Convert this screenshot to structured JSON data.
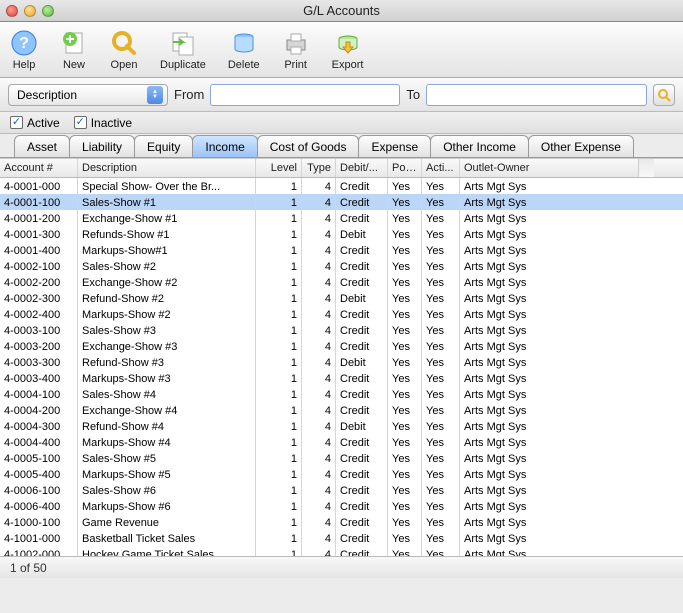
{
  "window": {
    "title": "G/L Accounts"
  },
  "toolbar": {
    "help": "Help",
    "new": "New",
    "open": "Open",
    "duplicate": "Duplicate",
    "delete": "Delete",
    "print": "Print",
    "export": "Export"
  },
  "search": {
    "field": "Description",
    "from_label": "From",
    "to_label": "To",
    "from_value": "",
    "to_value": ""
  },
  "filters": {
    "active_label": "Active",
    "inactive_label": "Inactive"
  },
  "tabs": [
    "Asset",
    "Liability",
    "Equity",
    "Income",
    "Cost of Goods",
    "Expense",
    "Other Income",
    "Other Expense"
  ],
  "active_tab": 3,
  "columns": {
    "acct": "Account #",
    "desc": "Description",
    "level": "Level",
    "type": "Type",
    "dc": "Debit/...",
    "posted": "Pos...",
    "active": "Acti...",
    "owner": "Outlet-Owner"
  },
  "rows": [
    {
      "acct": "4-0001-000",
      "desc": "Special Show- Over the Br...",
      "level": "1",
      "type": "4",
      "dc": "Credit",
      "posted": "Yes",
      "active": "Yes",
      "owner": "Arts Mgt Sys"
    },
    {
      "acct": "4-0001-100",
      "desc": "Sales-Show #1",
      "level": "1",
      "type": "4",
      "dc": "Credit",
      "posted": "Yes",
      "active": "Yes",
      "owner": "Arts Mgt Sys",
      "selected": true
    },
    {
      "acct": "4-0001-200",
      "desc": "Exchange-Show #1",
      "level": "1",
      "type": "4",
      "dc": "Credit",
      "posted": "Yes",
      "active": "Yes",
      "owner": "Arts Mgt Sys"
    },
    {
      "acct": "4-0001-300",
      "desc": "Refunds-Show #1",
      "level": "1",
      "type": "4",
      "dc": "Debit",
      "posted": "Yes",
      "active": "Yes",
      "owner": "Arts Mgt Sys"
    },
    {
      "acct": "4-0001-400",
      "desc": "Markups-Show#1",
      "level": "1",
      "type": "4",
      "dc": "Credit",
      "posted": "Yes",
      "active": "Yes",
      "owner": "Arts Mgt Sys"
    },
    {
      "acct": "4-0002-100",
      "desc": "Sales-Show #2",
      "level": "1",
      "type": "4",
      "dc": "Credit",
      "posted": "Yes",
      "active": "Yes",
      "owner": "Arts Mgt Sys"
    },
    {
      "acct": "4-0002-200",
      "desc": "Exchange-Show #2",
      "level": "1",
      "type": "4",
      "dc": "Credit",
      "posted": "Yes",
      "active": "Yes",
      "owner": "Arts Mgt Sys"
    },
    {
      "acct": "4-0002-300",
      "desc": "Refund-Show #2",
      "level": "1",
      "type": "4",
      "dc": "Debit",
      "posted": "Yes",
      "active": "Yes",
      "owner": "Arts Mgt Sys"
    },
    {
      "acct": "4-0002-400",
      "desc": "Markups-Show #2",
      "level": "1",
      "type": "4",
      "dc": "Credit",
      "posted": "Yes",
      "active": "Yes",
      "owner": "Arts Mgt Sys"
    },
    {
      "acct": "4-0003-100",
      "desc": "Sales-Show #3",
      "level": "1",
      "type": "4",
      "dc": "Credit",
      "posted": "Yes",
      "active": "Yes",
      "owner": "Arts Mgt Sys"
    },
    {
      "acct": "4-0003-200",
      "desc": "Exchange-Show #3",
      "level": "1",
      "type": "4",
      "dc": "Credit",
      "posted": "Yes",
      "active": "Yes",
      "owner": "Arts Mgt Sys"
    },
    {
      "acct": "4-0003-300",
      "desc": "Refund-Show #3",
      "level": "1",
      "type": "4",
      "dc": "Debit",
      "posted": "Yes",
      "active": "Yes",
      "owner": "Arts Mgt Sys"
    },
    {
      "acct": "4-0003-400",
      "desc": "Markups-Show #3",
      "level": "1",
      "type": "4",
      "dc": "Credit",
      "posted": "Yes",
      "active": "Yes",
      "owner": "Arts Mgt Sys"
    },
    {
      "acct": "4-0004-100",
      "desc": "Sales-Show #4",
      "level": "1",
      "type": "4",
      "dc": "Credit",
      "posted": "Yes",
      "active": "Yes",
      "owner": "Arts Mgt Sys"
    },
    {
      "acct": "4-0004-200",
      "desc": "Exchange-Show #4",
      "level": "1",
      "type": "4",
      "dc": "Credit",
      "posted": "Yes",
      "active": "Yes",
      "owner": "Arts Mgt Sys"
    },
    {
      "acct": "4-0004-300",
      "desc": "Refund-Show #4",
      "level": "1",
      "type": "4",
      "dc": "Debit",
      "posted": "Yes",
      "active": "Yes",
      "owner": "Arts Mgt Sys"
    },
    {
      "acct": "4-0004-400",
      "desc": "Markups-Show #4",
      "level": "1",
      "type": "4",
      "dc": "Credit",
      "posted": "Yes",
      "active": "Yes",
      "owner": "Arts Mgt Sys"
    },
    {
      "acct": "4-0005-100",
      "desc": "Sales-Show #5",
      "level": "1",
      "type": "4",
      "dc": "Credit",
      "posted": "Yes",
      "active": "Yes",
      "owner": "Arts Mgt Sys"
    },
    {
      "acct": "4-0005-400",
      "desc": "Markups-Show #5",
      "level": "1",
      "type": "4",
      "dc": "Credit",
      "posted": "Yes",
      "active": "Yes",
      "owner": "Arts Mgt Sys"
    },
    {
      "acct": "4-0006-100",
      "desc": "Sales-Show #6",
      "level": "1",
      "type": "4",
      "dc": "Credit",
      "posted": "Yes",
      "active": "Yes",
      "owner": "Arts Mgt Sys"
    },
    {
      "acct": "4-0006-400",
      "desc": "Markups-Show #6",
      "level": "1",
      "type": "4",
      "dc": "Credit",
      "posted": "Yes",
      "active": "Yes",
      "owner": "Arts Mgt Sys"
    },
    {
      "acct": "4-1000-100",
      "desc": "Game Revenue",
      "level": "1",
      "type": "4",
      "dc": "Credit",
      "posted": "Yes",
      "active": "Yes",
      "owner": "Arts Mgt Sys"
    },
    {
      "acct": "4-1001-000",
      "desc": "Basketball Ticket Sales",
      "level": "1",
      "type": "4",
      "dc": "Credit",
      "posted": "Yes",
      "active": "Yes",
      "owner": "Arts Mgt Sys"
    },
    {
      "acct": "4-1002-000",
      "desc": "Hockey Game Ticket Sales",
      "level": "1",
      "type": "4",
      "dc": "Credit",
      "posted": "Yes",
      "active": "Yes",
      "owner": "Arts Mgt Sys"
    }
  ],
  "status": "1 of 50"
}
